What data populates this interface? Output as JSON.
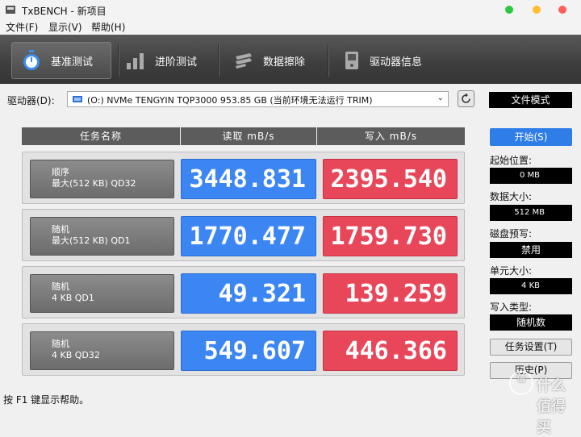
{
  "window": {
    "title": "TxBENCH - 新项目"
  },
  "menu": [
    "文件(F)",
    "显示(V)",
    "帮助(H)"
  ],
  "toolbar": {
    "tabs": [
      {
        "label": "基准测试",
        "icon": "stopwatch-icon",
        "active": true
      },
      {
        "label": "进阶测试",
        "icon": "bar-chart-icon",
        "active": false
      },
      {
        "label": "数据擦除",
        "icon": "eraser-icon",
        "active": false
      },
      {
        "label": "驱动器信息",
        "icon": "drive-info-icon",
        "active": false
      }
    ]
  },
  "drive": {
    "label": "驱动器(D):",
    "selected": "(O:) NVMe TENGYIN TQP3000  953.85 GB (当前环境无法运行 TRIM)",
    "mode_button": "文件模式"
  },
  "table": {
    "headers": {
      "task": "任务名称",
      "read": "读取 mB/s",
      "write": "写入 mB/s"
    },
    "rows": [
      {
        "line1": "顺序",
        "line2": "最大(512 KB) QD32",
        "read": "3448.831",
        "write": "2395.540"
      },
      {
        "line1": "随机",
        "line2": "最大(512 KB) QD1",
        "read": "1770.477",
        "write": "1759.730"
      },
      {
        "line1": "随机",
        "line2": "4 KB QD1",
        "read": "49.321",
        "write": "139.259"
      },
      {
        "line1": "随机",
        "line2": "4 KB QD32",
        "read": "549.607",
        "write": "446.366"
      }
    ]
  },
  "side": {
    "start_button": "开始(S)",
    "start_pos_label": "起始位置:",
    "start_pos_value": "0 MB",
    "data_size_label": "数据大小:",
    "data_size_value": "512 MB",
    "precondition_label": "磁盘预写:",
    "precondition_value": "禁用",
    "unit_size_label": "单元大小:",
    "unit_size_value": "4 KB",
    "write_type_label": "写入类型:",
    "write_type_value": "随机数",
    "task_settings_button": "任务设置(T)",
    "history_button": "历史(P)"
  },
  "status": {
    "text": "按 F1 键显示帮助。"
  },
  "watermark": {
    "text": "值 什么值得买"
  },
  "colors": {
    "read": "#3c86f3",
    "write": "#e8475a",
    "accent": "#2f7de6"
  }
}
